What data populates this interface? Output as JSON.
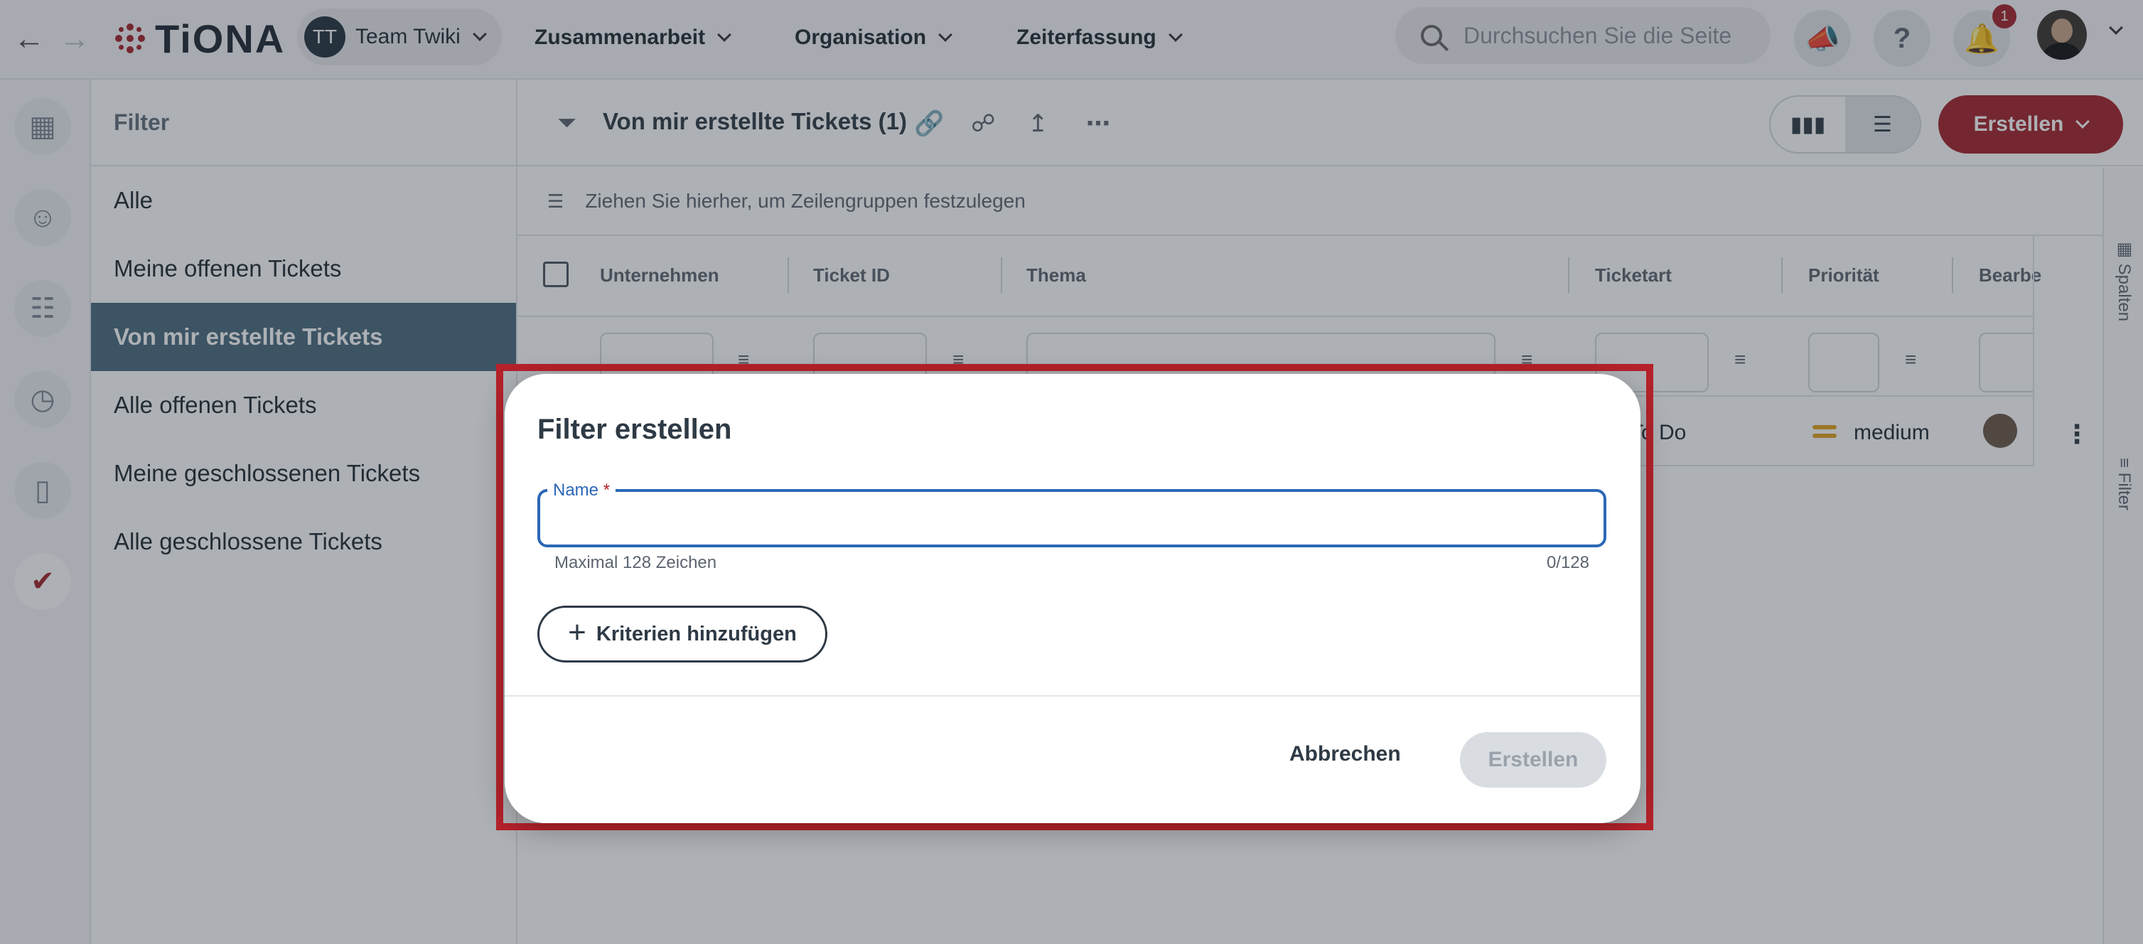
{
  "topbar": {
    "logo_text": "TiONA",
    "team": {
      "initials": "TT",
      "name": "Team Twiki"
    },
    "menu": [
      {
        "label": "Zusammenarbeit"
      },
      {
        "label": "Organisation"
      },
      {
        "label": "Zeiterfassung"
      }
    ],
    "search_placeholder": "Durchsuchen Sie die Seite",
    "notifications_count": "1"
  },
  "filter_panel": {
    "title": "Filter",
    "items": [
      {
        "label": "Alle"
      },
      {
        "label": "Meine offenen Tickets"
      },
      {
        "label": "Von mir erstellte Tickets"
      },
      {
        "label": "Alle offenen Tickets"
      },
      {
        "label": "Meine geschlossenen Tickets"
      },
      {
        "label": "Alle geschlossene Tickets"
      }
    ],
    "active_index": 2
  },
  "main": {
    "view_title": "Von mir erstellte Tickets  (1)",
    "create_label": "Erstellen",
    "group_hint": "Ziehen Sie hierher, um Zeilengruppen festzulegen",
    "columns": [
      {
        "label": "Unternehmen"
      },
      {
        "label": "Ticket ID"
      },
      {
        "label": "Thema"
      },
      {
        "label": "Ticketart"
      },
      {
        "label": "Priorität"
      },
      {
        "label": "Bearbe"
      }
    ],
    "row": {
      "status": "To Do",
      "priority": "medium"
    },
    "side_tabs": {
      "columns": "Spalten",
      "filter": "Filter"
    }
  },
  "dialog": {
    "title": "Filter erstellen",
    "name_label": "Name",
    "required_mark": "*",
    "name_value": "",
    "hint": "Maximal 128 Zeichen",
    "counter": "0/128",
    "add_criteria_label": "Kriterien hinzufügen",
    "cancel_label": "Abbrechen",
    "submit_label": "Erstellen"
  },
  "colors": {
    "brand_red": "#a3232a",
    "active_filter_bg": "#4a6b7f",
    "focus_blue": "#2c67b6",
    "priority_medium": "#e0a420"
  }
}
